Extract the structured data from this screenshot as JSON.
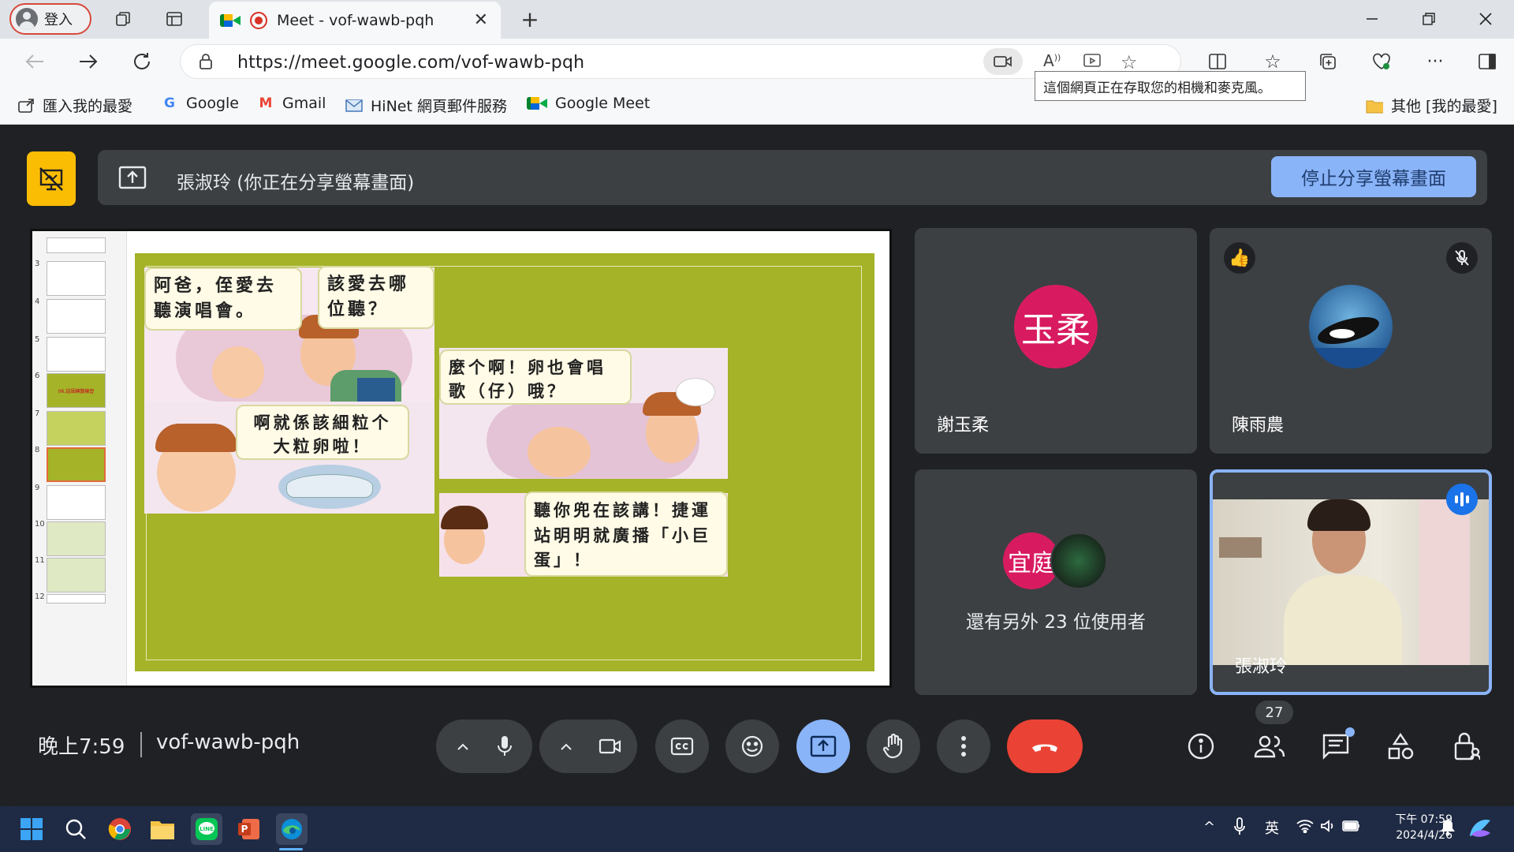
{
  "browser": {
    "profile_label": "登入",
    "tab_title": "Meet - vof-wawb-pqh",
    "url": "https://meet.google.com/vof-wawb-pqh",
    "tooltip": "這個網頁正在存取您的相機和麥克風。",
    "bookmarks": [
      {
        "label": "匯入我的最愛",
        "icon": "import-icon"
      },
      {
        "label": "Google",
        "icon": "google-icon"
      },
      {
        "label": "Gmail",
        "icon": "gmail-icon"
      },
      {
        "label": "HiNet 網頁郵件服務",
        "icon": "mail-icon"
      },
      {
        "label": "Google Meet",
        "icon": "meet-icon"
      }
    ],
    "other_favorites": "其他 [我的最愛]"
  },
  "meet": {
    "presenter_text": "張淑玲 (你正在分享螢幕畫面)",
    "stop_share_label": "停止分享螢幕畫面",
    "slide": {
      "bubble1": "阿爸，侄愛去聽演唱會。",
      "bubble2": "該愛去哪位聽？",
      "bubble3": "啊就係該細粒个大粒卵啦！",
      "bubble4": "麼个啊！卵也會唱歌（仔）哦？",
      "bubble5": "聽你兜在該講！捷運站明明就廣播「小巨蛋」！",
      "slide_numbers": [
        "3",
        "4",
        "5",
        "6",
        "7",
        "8",
        "9",
        "10",
        "11",
        "12"
      ],
      "thumb6_text": "06.話語轉變練習"
    },
    "tiles": [
      {
        "name": "謝玉柔",
        "avatar_text": "玉柔",
        "avatar_color": "#d81b60"
      },
      {
        "name": "陳雨農",
        "reaction": "👍",
        "muted": true
      },
      {
        "avatar_text": "宜庭",
        "others_text": "還有另外 23 位使用者",
        "avatar_color": "#d81b60"
      },
      {
        "name": "張淑玲",
        "speaking": true
      }
    ],
    "time": "晚上7:59",
    "meeting_code": "vof-wawb-pqh",
    "participant_count": "27",
    "accent_blue": "#8ab4f8",
    "end_call_color": "#ea4335"
  },
  "taskbar": {
    "ime": "英",
    "time": "下午 07:59",
    "date": "2024/4/26"
  }
}
